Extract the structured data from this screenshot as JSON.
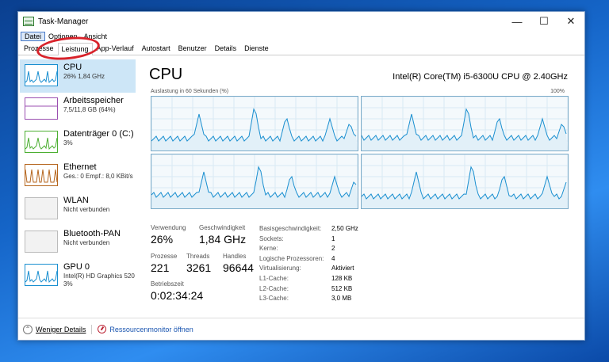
{
  "window": {
    "title": "Task-Manager",
    "controls": {
      "minimize": "—",
      "maximize": "☐",
      "close": "✕"
    }
  },
  "menu": [
    "Datei",
    "Optionen",
    "Ansicht"
  ],
  "tabs": [
    "Prozesse",
    "Leistung",
    "App-Verlauf",
    "Autostart",
    "Benutzer",
    "Details",
    "Dienste"
  ],
  "active_tab": "Leistung",
  "sidebar": [
    {
      "name": "CPU",
      "sub": "26% 1,84 GHz",
      "color": "#1a8fd0",
      "selected": true
    },
    {
      "name": "Arbeitsspeicher",
      "sub": "7,5/11,8 GB (64%)",
      "color": "#9b4fb0"
    },
    {
      "name": "Datenträger 0 (C:)",
      "sub": "3%",
      "color": "#4caf32"
    },
    {
      "name": "Ethernet",
      "sub": "Ges.: 0 Empf.: 8,0 KBit/s",
      "color": "#b5651d"
    },
    {
      "name": "WLAN",
      "sub": "Nicht verbunden",
      "color": "#bbbbbb"
    },
    {
      "name": "Bluetooth-PAN",
      "sub": "Nicht verbunden",
      "color": "#bbbbbb"
    },
    {
      "name": "GPU 0",
      "sub": "Intel(R) HD Graphics 520",
      "sub2": "3%",
      "color": "#1a8fd0"
    }
  ],
  "main": {
    "title": "CPU",
    "model": "Intel(R) Core(TM) i5-6300U CPU @ 2.40GHz",
    "graph_label": "Auslastung in 60 Sekunden (%)",
    "graph_max": "100%",
    "graph_color": "#1a8fd0",
    "stats": {
      "utilization_label": "Verwendung",
      "utilization": "26%",
      "speed_label": "Geschwindigkeit",
      "speed": "1,84 GHz",
      "processes_label": "Prozesse",
      "processes": "221",
      "threads_label": "Threads",
      "threads": "3261",
      "handles_label": "Handles",
      "handles": "96644",
      "uptime_label": "Betriebszeit",
      "uptime": "0:02:34:24"
    },
    "details": [
      {
        "key": "Basisgeschwindigkeit:",
        "value": "2,50 GHz"
      },
      {
        "key": "Sockets:",
        "value": "1"
      },
      {
        "key": "Kerne:",
        "value": "2"
      },
      {
        "key": "Logische Prozessoren:",
        "value": "4"
      },
      {
        "key": "Virtualisierung:",
        "value": "Aktiviert"
      },
      {
        "key": "L1-Cache:",
        "value": "128 KB"
      },
      {
        "key": "L2-Cache:",
        "value": "512 KB"
      },
      {
        "key": "L3-Cache:",
        "value": "3,0 MB"
      }
    ]
  },
  "footer": {
    "fewer_details": "Weniger Details",
    "resource_monitor": "Ressourcenmonitor öffnen"
  },
  "annotation_color": "#d8222a"
}
